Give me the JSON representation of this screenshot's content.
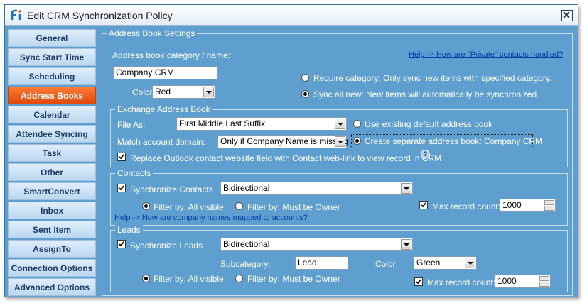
{
  "window": {
    "title": "Edit CRM Synchronization Policy"
  },
  "sidebar": {
    "items": [
      {
        "label": "General"
      },
      {
        "label": "Sync Start Time"
      },
      {
        "label": "Scheduling"
      },
      {
        "label": "Address Books"
      },
      {
        "label": "Calendar"
      },
      {
        "label": "Attendee Syncing"
      },
      {
        "label": "Task"
      },
      {
        "label": "Other"
      },
      {
        "label": "SmartConvert"
      },
      {
        "label": "Inbox"
      },
      {
        "label": "Sent Item"
      },
      {
        "label": "AssignTo"
      },
      {
        "label": "Connection Options"
      },
      {
        "label": "Advanced Options"
      }
    ],
    "active_item": "Address Books"
  },
  "address_book_settings": {
    "legend": "Address Book Settings",
    "category_label": "Address book category / name:",
    "help_link": "Help -> How are \"Private\" contacts handled?",
    "category_value": "Company CRM",
    "color_label": "Color:",
    "color_value": "Red",
    "require_category": "Require category: Only sync new items with specified category.",
    "sync_all_new": "Sync all new: New items will automatically be synchronized.",
    "selected_mode": "Sync all new"
  },
  "exchange_address_book": {
    "legend": "Exchange Address Book",
    "file_as_label": "File As:",
    "file_as_value": "First Middle Last Suffix",
    "match_domain_label": "Match account domain:",
    "match_domain_value": "Only if Company Name is missing",
    "use_existing": "Use existing default address book",
    "create_separate": "Create separate address book: Company CRM",
    "selected_option": "Create separate address book",
    "replace_website": "Replace Outlook contact website field with Contact web-link to view record in CRM",
    "replace_website_checked": true,
    "help_icon": "question-icon"
  },
  "contacts": {
    "legend": "Contacts",
    "sync_label": "Synchronize Contacts",
    "sync_checked": true,
    "direction": "Bidirectional",
    "filter_all": "Filter by: All visible",
    "filter_owner": "Filter by: Must be Owner",
    "selected_filter": "All visible",
    "max_label": "Max record count:",
    "max_checked": true,
    "max_value": "1000",
    "help_link": "Help -> How are company names mapped to accounts?"
  },
  "leads": {
    "legend": "Leads",
    "sync_label": "Synchronize Leads",
    "sync_checked": true,
    "direction": "Bidirectional",
    "subcategory_label": "Subcategory:",
    "subcategory_value": "Lead",
    "color_label": "Color:",
    "color_value": "Green",
    "filter_all": "Filter by: All visible",
    "filter_owner": "Filter by: Must be Owner",
    "selected_filter": "All visible",
    "max_label": "Max record count:",
    "max_checked": true,
    "max_value": "1000"
  },
  "colors": {
    "panel_bg": "#5e9fd0",
    "active_nav": "#e14a0c",
    "link": "#003fa8"
  }
}
